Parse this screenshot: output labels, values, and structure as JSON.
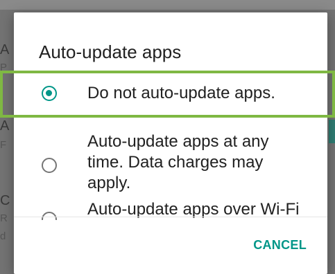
{
  "dialog": {
    "title": "Auto-update apps",
    "options": [
      {
        "label": "Do not auto-update apps.",
        "selected": true
      },
      {
        "label": "Auto-update apps at any time. Data charges may apply.",
        "selected": false
      },
      {
        "label": "Auto-update apps over Wi-Fi only.",
        "selected": false
      }
    ],
    "cancel_label": "CANCEL"
  },
  "background": {
    "fragments": [
      "A",
      "P",
      "A",
      "F",
      "C",
      "R",
      "d"
    ]
  },
  "colors": {
    "accent": "#009688",
    "highlight": "#7fb843"
  }
}
